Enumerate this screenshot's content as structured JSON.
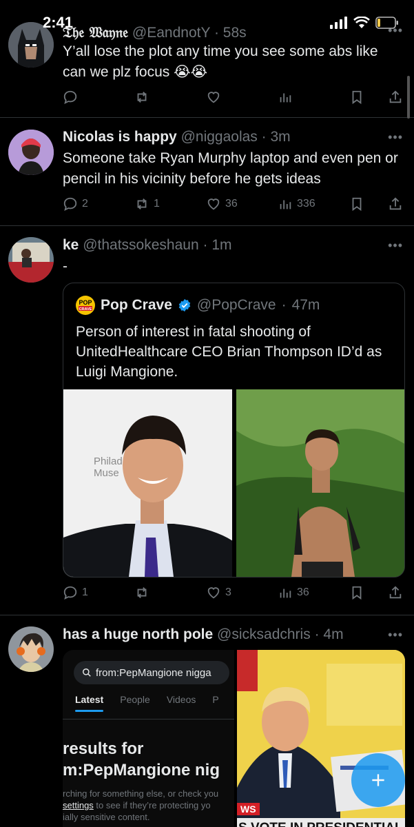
{
  "status": {
    "time": "2:41"
  },
  "tweets": [
    {
      "name": "𝔗𝔥𝔢 𝔚𝔞𝔶𝔫𝔢",
      "handle": "@EandnotY",
      "sep": "·",
      "time": "58s",
      "text": "Y’all lose the plot any time you see some abs like can we plz focus 😭😭",
      "replies": "",
      "retweets": "",
      "likes": "",
      "views": ""
    },
    {
      "name": "Nicolas is happy",
      "handle": "@niggaolas",
      "sep": "·",
      "time": "3m",
      "text": "Someone take Ryan Murphy laptop and even pen or pencil in his vicinity before he gets ideas",
      "replies": "2",
      "retweets": "1",
      "likes": "36",
      "views": "336"
    },
    {
      "name": "ke",
      "handle": "@thatssokeshaun",
      "sep": "·",
      "time": "1m",
      "text": "-",
      "quote": {
        "name": "Pop Crave",
        "handle": "@PopCrave",
        "sep": "·",
        "time": "47m",
        "text": "Person of interest in fatal shooting of UnitedHealthcare CEO Brian Thompson ID’d as Luigi Mangione.",
        "logo_text": "POP CRAVE",
        "backdrop_text_1": "Philad",
        "backdrop_text_2": "Muse"
      },
      "replies": "1",
      "retweets": "",
      "likes": "3",
      "views": "36"
    },
    {
      "name": "has a huge north pole",
      "handle": "@sicksadchris",
      "sep": "·",
      "time": "4m",
      "embedded": {
        "search_query": "from:PepMangione nigga",
        "tabs": [
          "Latest",
          "People",
          "Videos",
          "P"
        ],
        "results_line1": "results for",
        "results_line2": "m:PepMangione nig",
        "sub_text_1": "rching for something else, or check you",
        "sub_link": "settings",
        "sub_text_2": " to see if they’re protecting yo",
        "sub_text_3": "ially sensitive content.",
        "news_tag": "WS",
        "news_ticker": "S VOTE IN PRESIDENTIAL"
      }
    }
  ],
  "colors": {
    "accent": "#1d9bf0",
    "muted": "#71767b",
    "divider": "#2f3336",
    "text": "#e7e9ea"
  }
}
